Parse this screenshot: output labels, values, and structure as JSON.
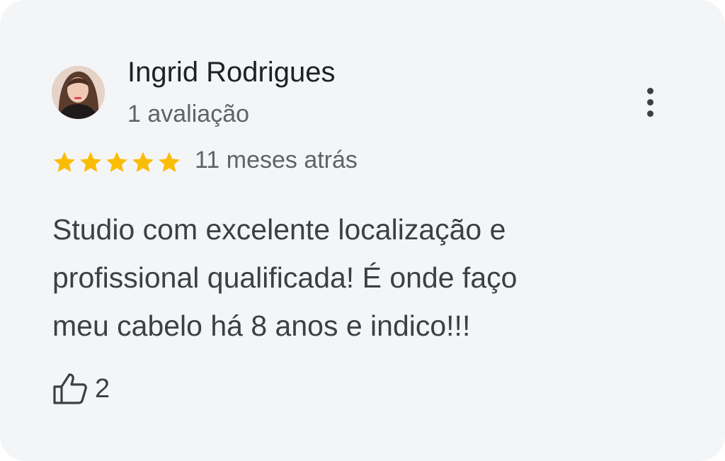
{
  "review": {
    "author_name": "Ingrid Rodrigues",
    "review_count": "1 avaliação",
    "rating": 5,
    "rating_max": 5,
    "time_ago": "11 meses atrás",
    "text_lines": [
      "Studio com excelente localização e",
      "profissional qualificada! É onde faço",
      "meu cabelo há 8 anos e indico!!!"
    ],
    "likes": "2"
  },
  "icons": {
    "more": "more-vert-icon",
    "like": "thumbs-up-icon",
    "star": "star-icon"
  },
  "colors": {
    "card_background": "#f4f5f7",
    "star": "#fbbc04",
    "name_text": "#202124",
    "secondary_text": "#5f6368",
    "body_text": "#3c4043"
  }
}
